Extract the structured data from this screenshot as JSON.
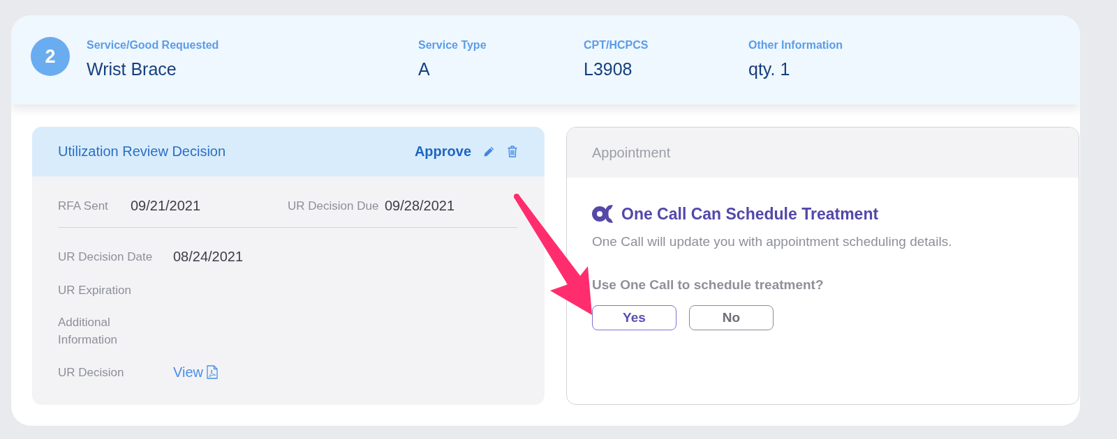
{
  "summary": {
    "number": "2",
    "fields": [
      {
        "label": "Service/Good Requested",
        "value": "Wrist Brace"
      },
      {
        "label": "Service Type",
        "value": "A"
      },
      {
        "label": "CPT/HCPCS",
        "value": "L3908"
      },
      {
        "label": "Other Information",
        "value": "qty. 1"
      }
    ]
  },
  "review_panel": {
    "title": "Utilization Review Decision",
    "decision": "Approve",
    "top_fields": [
      {
        "label": "RFA Sent",
        "value": "09/21/2021"
      },
      {
        "label": "UR Decision Due",
        "value": "09/28/2021"
      }
    ],
    "fields": [
      {
        "label": "UR Decision Date",
        "kind": "text",
        "value": "08/24/2021"
      },
      {
        "label": "UR Expiration",
        "kind": "text"
      },
      {
        "label": "Additional Information",
        "kind": "text"
      },
      {
        "label": "UR Decision",
        "kind": "link",
        "value": "View"
      }
    ]
  },
  "appointment_panel": {
    "title": "Appointment",
    "heading": "One Call Can Schedule Treatment",
    "description": "One Call will update you with appointment scheduling details.",
    "question": "Use One Call to schedule treatment?",
    "options": [
      {
        "label": "Yes",
        "selected": true
      },
      {
        "label": "No",
        "selected": false
      }
    ]
  }
}
